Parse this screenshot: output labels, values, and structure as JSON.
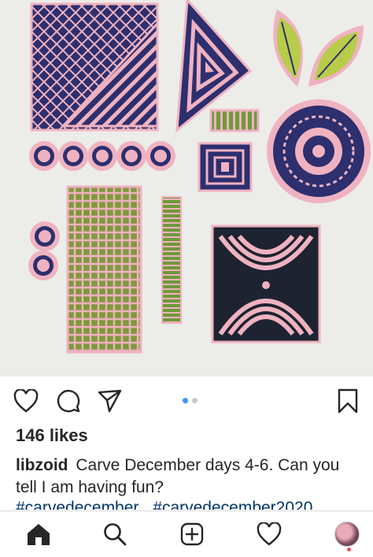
{
  "post": {
    "image_alt_icon": "carved-stamps-photo",
    "carousel": {
      "count": 2,
      "active_index": 0
    },
    "likes_text": "146 likes",
    "caption": {
      "username": "libzoid",
      "text": "Carve December days 4-6. Can you tell I am having fun?",
      "hashtags": [
        "#carvedecember",
        "#carvedecember2020"
      ]
    }
  },
  "colors": {
    "link": "#003569",
    "accent_blue": "#3897f0",
    "stamp_pink": "#efb2c0",
    "stamp_navy": "#2d2f6e",
    "stamp_green": "#7e9a3c"
  },
  "actions": [
    "heart-icon",
    "comment-icon",
    "share-icon",
    "bookmark-icon"
  ],
  "nav": [
    "home-icon",
    "search-icon",
    "new-post-icon",
    "activity-icon",
    "profile-avatar"
  ]
}
